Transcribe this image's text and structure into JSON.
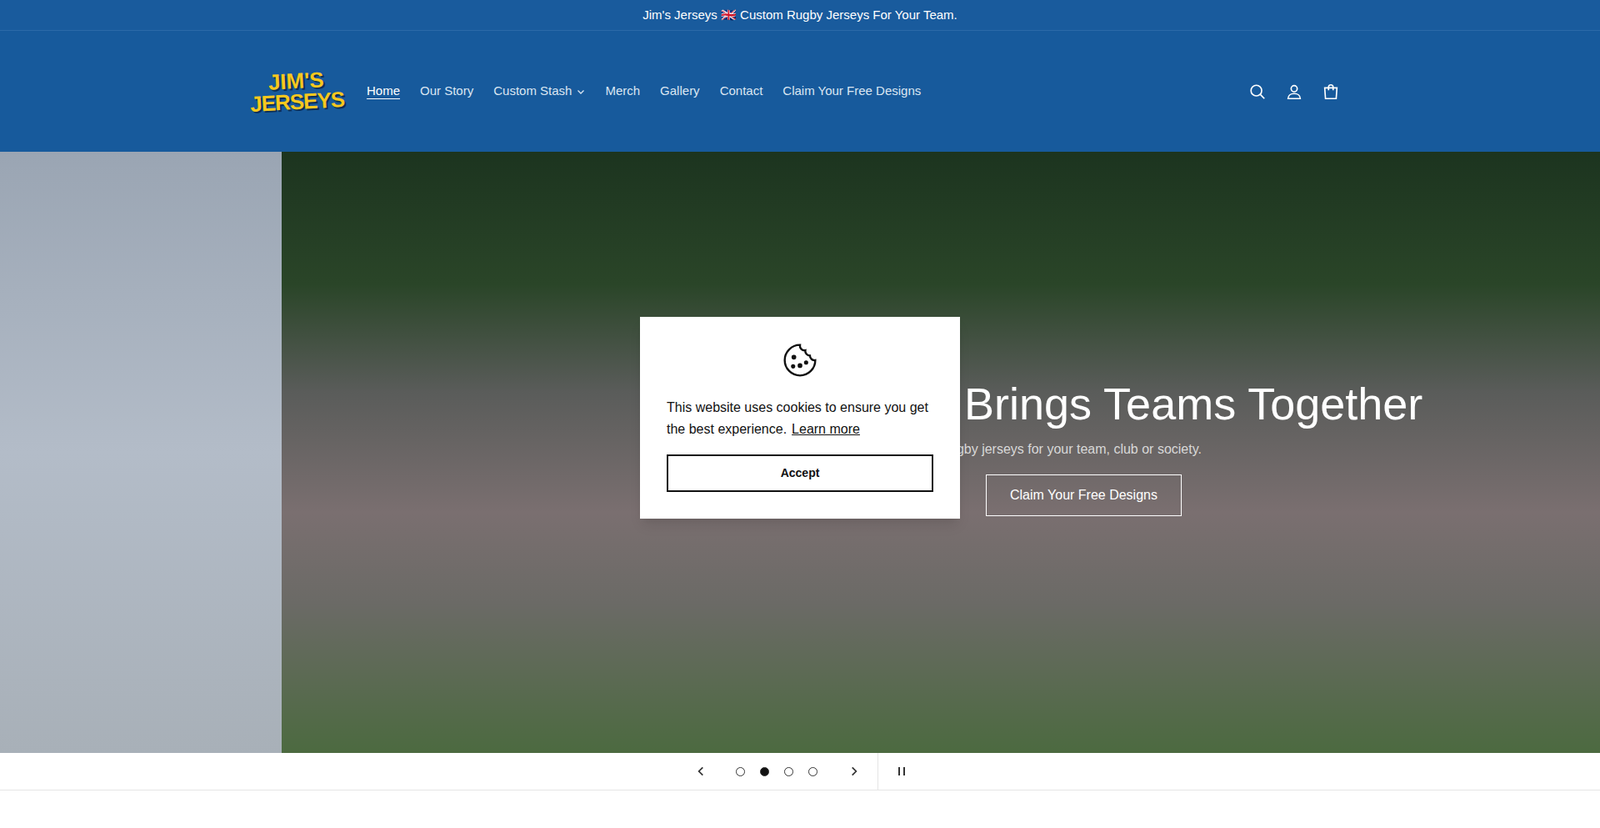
{
  "announcement": "Jim's Jerseys 🇬🇧 Custom Rugby Jerseys For Your Team.",
  "logo": {
    "line1": "JIM'S",
    "line2": "JERSEYS"
  },
  "nav": [
    {
      "label": "Home",
      "selected": true,
      "has_dropdown": false
    },
    {
      "label": "Our Story",
      "selected": false,
      "has_dropdown": false
    },
    {
      "label": "Custom Stash",
      "selected": false,
      "has_dropdown": true
    },
    {
      "label": "Merch",
      "selected": false,
      "has_dropdown": false
    },
    {
      "label": "Gallery",
      "selected": false,
      "has_dropdown": false
    },
    {
      "label": "Contact",
      "selected": false,
      "has_dropdown": false
    },
    {
      "label": "Claim Your Free Designs",
      "selected": false,
      "has_dropdown": false
    }
  ],
  "hero": {
    "heading": "t Brings Teams Together",
    "subheading": "ugby jerseys for your team, club or society.",
    "button": "Claim Your Free Designs"
  },
  "slides": [
    {
      "selected": false
    },
    {
      "selected": true
    },
    {
      "selected": false
    },
    {
      "selected": false
    }
  ],
  "cookie": {
    "message": "This website uses cookies to ensure you get the best experience.",
    "link": "Learn more",
    "button": "Accept"
  }
}
